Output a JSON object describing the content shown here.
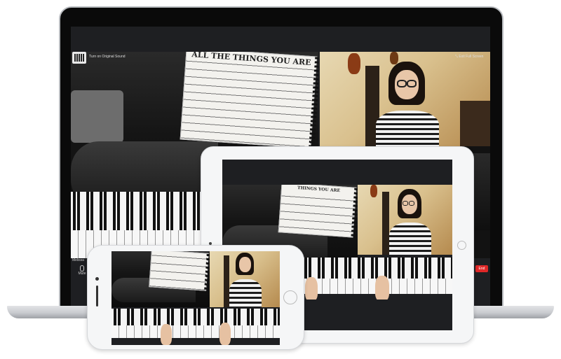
{
  "meeting": {
    "participant_name": "Melissa",
    "original_sound_label": "Turn on Original Sound",
    "exit_fullscreen_label": "Exit Full Screen",
    "mute_label": "Mute",
    "end_label": "End",
    "sheet_music_title": "ALL THE THINGS YOU ARE",
    "sheet_music_title_small": "THINGS YOU ARE"
  },
  "colors": {
    "end_button": "#e02828",
    "zoom_toolbar": "#1e1f22",
    "device_frame": "#f5f6f7",
    "laptop_silver": "#c9cbcf"
  },
  "icons": {
    "original_sound": "mic-with-music-icon",
    "exit_fullscreen": "collapse-arrows-icon",
    "mute": "microphone-icon"
  }
}
